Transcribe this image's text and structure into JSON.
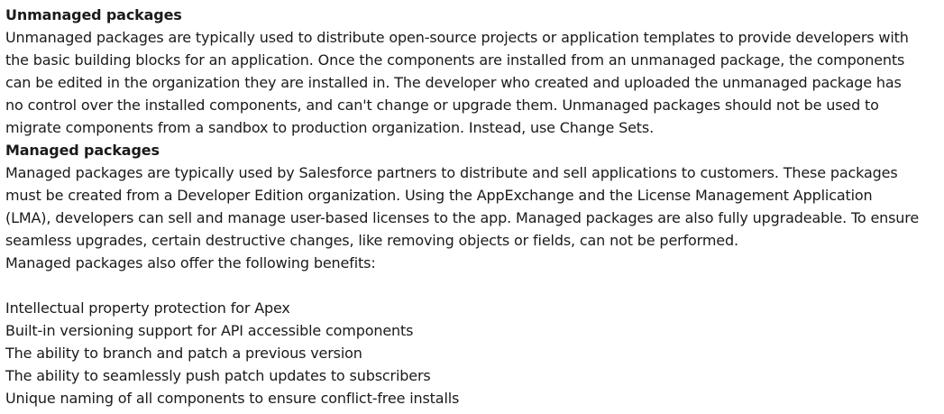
{
  "sections": {
    "unmanaged": {
      "heading": "Unmanaged packages",
      "lines": [
        "Unmanaged packages are typically used to distribute open-source projects or application templates to provide developers with",
        "the basic building blocks for an application. Once the components are installed from an unmanaged package, the components",
        "can be edited in the organization they are installed in. The developer who created and uploaded the unmanaged package has",
        "no control over the installed components, and can't change or upgrade them. Unmanaged packages should not be used to",
        "migrate components from a sandbox to production organization. Instead, use Change Sets."
      ]
    },
    "managed": {
      "heading": "Managed packages",
      "lines": [
        "Managed packages are typically used by Salesforce partners to distribute and sell applications to customers. These packages",
        "must be created from a Developer Edition organization. Using the AppExchange and the License Management Application",
        "(LMA), developers can sell and manage user-based licenses to the app. Managed packages are also fully upgradeable. To ensure",
        "seamless upgrades, certain destructive changes, like removing objects or fields, can not be performed.",
        "Managed packages also offer the following benefits:"
      ],
      "benefits": [
        "Intellectual property protection for Apex",
        "Built-in versioning support for API accessible components",
        "The ability to branch and patch a previous version",
        "The ability to seamlessly push patch updates to subscribers",
        "Unique naming of all components to ensure conflict-free installs"
      ]
    }
  }
}
